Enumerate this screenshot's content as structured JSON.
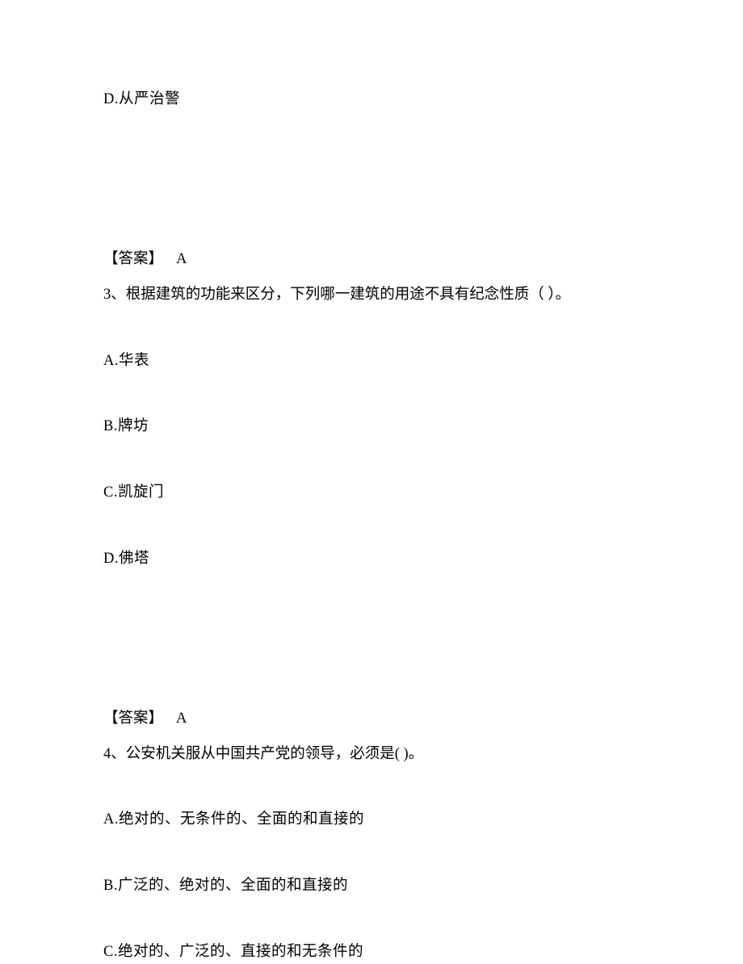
{
  "q2": {
    "option_d": "D.从严治警",
    "answer_label": "【答案】",
    "answer_value": "A"
  },
  "q3": {
    "stem": "3、根据建筑的功能来区分，下列哪一建筑的用途不具有纪念性质（   ）。",
    "option_a": "A.华表",
    "option_b": "B.牌坊",
    "option_c": "C.凯旋门",
    "option_d": "D.佛塔",
    "answer_label": "【答案】",
    "answer_value": "A"
  },
  "q4": {
    "stem": "4、公安机关服从中国共产党的领导，必须是(    )。",
    "option_a": "A.绝对的、无条件的、全面的和直接的",
    "option_b": "B.广泛的、绝对的、全面的和直接的",
    "option_c": "C.绝对的、广泛的、直接的和无条件的"
  }
}
